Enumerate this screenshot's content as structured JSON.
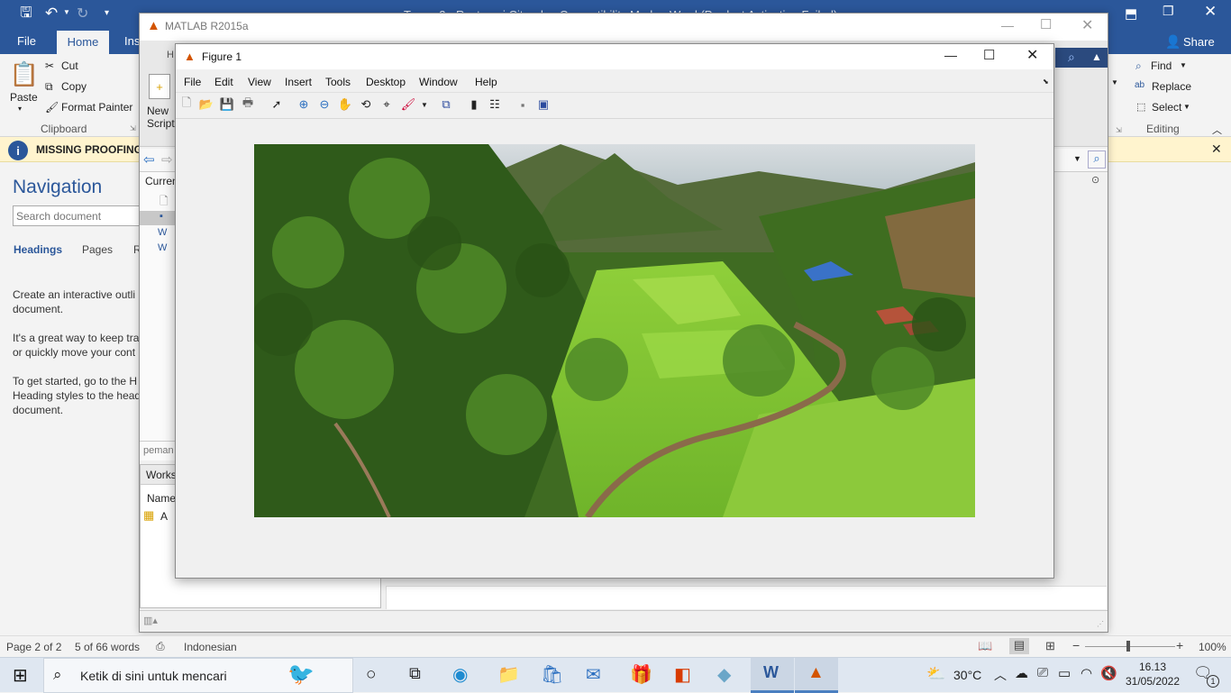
{
  "word": {
    "doc_title": "Tugas 2 - Restorasi Citra dan Compatibility Mode - Word (Product Activation Failed)",
    "tabs": [
      "File",
      "Home",
      "Ins"
    ],
    "share_label": "Share",
    "clipboard": {
      "paste": "Paste",
      "cut": "Cut",
      "copy": "Copy",
      "format_painter": "Format Painter",
      "group": "Clipboard"
    },
    "editing": {
      "find": "Find",
      "replace": "Replace",
      "select": "Select",
      "group": "Editing"
    },
    "message_bar": "MISSING PROOFING",
    "navigation": {
      "title": "Navigation",
      "search_placeholder": "Search document",
      "tabs": [
        "Headings",
        "Pages",
        "R"
      ],
      "p1": "Create an interactive outli",
      "p1b": "document.",
      "p2": "It's a great way to keep trac",
      "p2b": "or quickly move your cont",
      "p3": "To get started, go to the H",
      "p3b": "Heading styles to the head",
      "p3c": "document."
    },
    "status": {
      "page": "Page 2 of 2",
      "words": "5 of 66 words",
      "language": "Indonesian",
      "zoom": "100%"
    }
  },
  "matlab": {
    "title": "MATLAB R2015a",
    "new_script": [
      "New",
      "Script"
    ],
    "current_folder": "Curren",
    "command_snippet": "peman",
    "workspace": "Works",
    "ws_col_name": "Name",
    "ws_var": "A"
  },
  "figure": {
    "title": "Figure 1",
    "menu": [
      "File",
      "Edit",
      "View",
      "Insert",
      "Tools",
      "Desktop",
      "Window",
      "Help"
    ]
  },
  "taskbar": {
    "search_placeholder": "Ketik di sini untuk mencari",
    "temperature": "30°C",
    "time": "16.13",
    "date": "31/05/2022",
    "notification_count": "1"
  }
}
